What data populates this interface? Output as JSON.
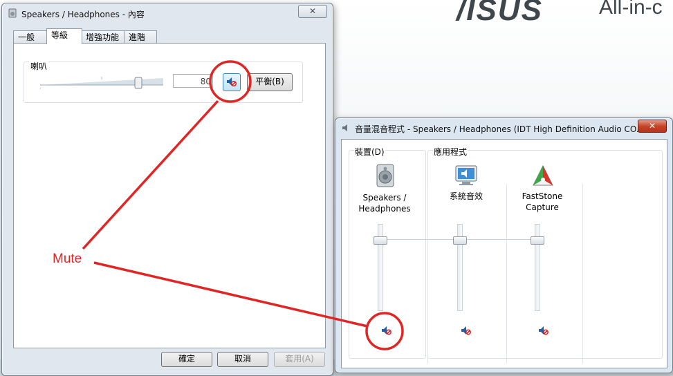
{
  "desktop": {
    "brand": "/ISUS",
    "brand_sub": "All-in-c"
  },
  "properties_dialog": {
    "title": "Speakers / Headphones - 內容",
    "tabs": [
      {
        "label": "一般",
        "active": false
      },
      {
        "label": "等級",
        "active": true
      },
      {
        "label": "增強功能",
        "active": false
      },
      {
        "label": "進階",
        "active": false
      }
    ],
    "speaker_group_label": "喇叭",
    "level_value": "80",
    "balance_button": "平衡(B)",
    "buttons": {
      "ok": "確定",
      "cancel": "取消",
      "apply": "套用(A)"
    },
    "close_glyph": "✕"
  },
  "mixer": {
    "title": "音量混音程式 - Speakers / Headphones (IDT High Definition Audio CO...",
    "device_label": "裝置(D)",
    "apps_label": "應用程式",
    "channels": [
      {
        "name_line1": "Speakers /",
        "name_line2": "Headphones",
        "icon": "speaker-device-icon"
      },
      {
        "name_line1": "系統音效",
        "name_line2": "",
        "icon": "system-sounds-icon"
      },
      {
        "name_line1": "FastStone",
        "name_line2": "Capture",
        "icon": "faststone-capture-icon"
      }
    ],
    "close_glyph": "✕"
  },
  "annotation": {
    "label": "Mute",
    "color": "#e02525"
  }
}
